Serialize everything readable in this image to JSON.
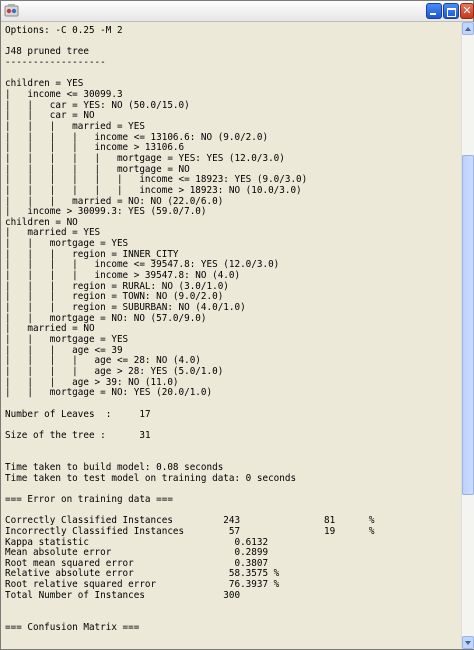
{
  "window": {
    "icon": "app-icon",
    "controls": [
      "minimize-icon",
      "maximize-icon",
      "close-icon"
    ],
    "close_glyph": "✕",
    "colors": {
      "titlebar": "#eeeeee",
      "content_bg": "#ece9d8",
      "button_blue": "#2a62e0",
      "button_red": "#d24a2c"
    }
  },
  "output": {
    "lines": [
      "Options: -C 0.25 -M 2",
      "",
      "J48 pruned tree",
      "------------------",
      "",
      "children = YES",
      "|   income <= 30099.3",
      "|   |   car = YES: NO (50.0/15.0)",
      "|   |   car = NO",
      "|   |   |   married = YES",
      "|   |   |   |   income <= 13106.6: NO (9.0/2.0)",
      "|   |   |   |   income > 13106.6",
      "|   |   |   |   |   mortgage = YES: YES (12.0/3.0)",
      "|   |   |   |   |   mortgage = NO",
      "|   |   |   |   |   |   income <= 18923: YES (9.0/3.0)",
      "|   |   |   |   |   |   income > 18923: NO (10.0/3.0)",
      "|   |   |   married = NO: NO (22.0/6.0)",
      "|   income > 30099.3: YES (59.0/7.0)",
      "children = NO",
      "|   married = YES",
      "|   |   mortgage = YES",
      "|   |   |   region = INNER_CITY",
      "|   |   |   |   income <= 39547.8: YES (12.0/3.0)",
      "|   |   |   |   income > 39547.8: NO (4.0)",
      "|   |   |   region = RURAL: NO (3.0/1.0)",
      "|   |   |   region = TOWN: NO (9.0/2.0)",
      "|   |   |   region = SUBURBAN: NO (4.0/1.0)",
      "|   |   mortgage = NO: NO (57.0/9.0)",
      "|   married = NO",
      "|   |   mortgage = YES",
      "|   |   |   age <= 39",
      "|   |   |   |   age <= 28: NO (4.0)",
      "|   |   |   |   age > 28: YES (5.0/1.0)",
      "|   |   |   age > 39: NO (11.0)",
      "|   |   mortgage = NO: YES (20.0/1.0)",
      "",
      "Number of Leaves  : \t17",
      "",
      "Size of the tree : \t31",
      "",
      "",
      "Time taken to build model: 0.08 seconds",
      "Time taken to test model on training data: 0 seconds",
      "",
      "=== Error on training data ===",
      "",
      "Correctly Classified Instances         243               81      %",
      "Incorrectly Classified Instances        57               19      %",
      "Kappa statistic                          0.6132",
      "Mean absolute error                      0.2899",
      "Root mean squared error                  0.3807",
      "Relative absolute error                 58.3575 %",
      "Root relative squared error             76.3937 %",
      "Total Number of Instances              300",
      "",
      "",
      "=== Confusion Matrix ==="
    ]
  },
  "scrollbar": {
    "up_icon": "scroll-up-arrow-icon",
    "down_icon": "scroll-down-arrow-icon"
  }
}
